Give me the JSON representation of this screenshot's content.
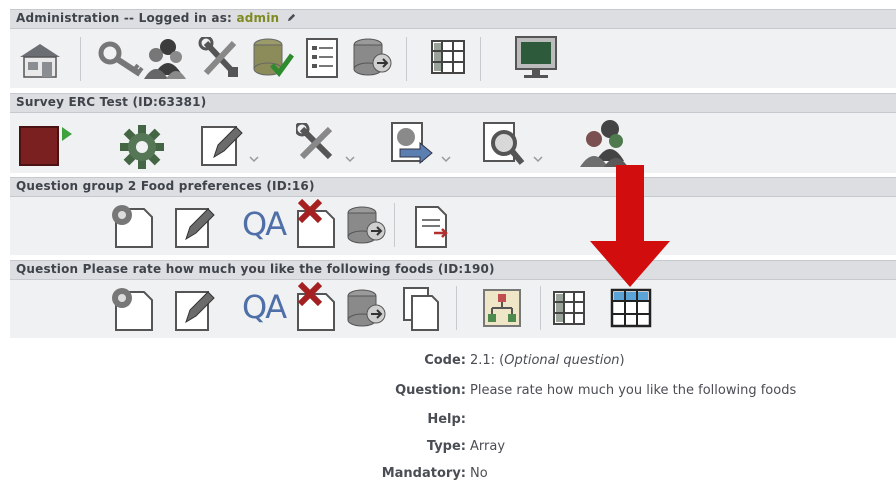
{
  "admin_bar": {
    "title": "Administration -- Logged in as: ",
    "user": "admin"
  },
  "survey_bar": {
    "title": "Survey ERC Test (ID:63381)"
  },
  "group_bar": {
    "title": "Question group 2 Food preferences (ID:16)"
  },
  "question_bar": {
    "title": "Question Please rate how much you like the following foods (ID:190)"
  },
  "qa_label": "QA",
  "details": {
    "code_label": "Code:",
    "code_value": "2.1: (",
    "code_optional": "Optional question",
    "code_close": ")",
    "question_label": "Question:",
    "question_value": "Please rate how much you like the following foods",
    "help_label": "Help:",
    "help_value": "",
    "type_label": "Type:",
    "type_value": "Array",
    "mandatory_label": "Mandatory:",
    "mandatory_value": "No"
  },
  "colors": {
    "band": "#dcdee2",
    "panel": "#f0f1f3",
    "arrow": "#d10d0d",
    "username": "#7f8a20"
  }
}
